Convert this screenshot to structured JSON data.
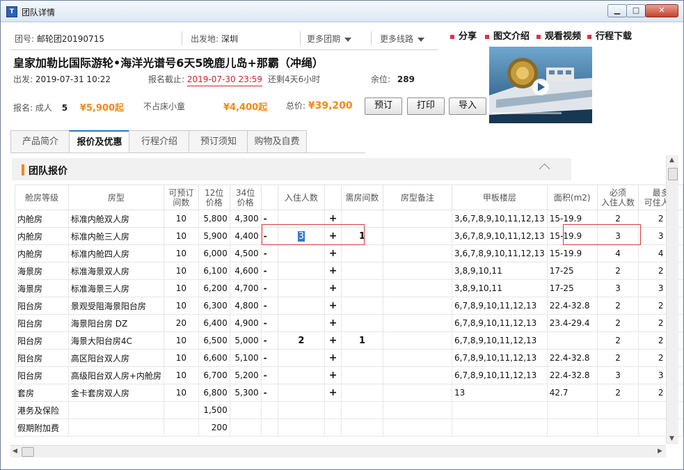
{
  "window": {
    "title": "团队详情",
    "icon": "app-icon",
    "min": "▁",
    "max": "□",
    "close": "✕"
  },
  "info": {
    "group_no_label": "团号:",
    "group_no": "邮轮团20190715",
    "depart_from_label": "出发地:",
    "depart_from": "深圳",
    "more_dates": "更多团期",
    "more_routes": "更多线路"
  },
  "links": [
    "分享",
    "图文介绍",
    "观看视频",
    "行程下载"
  ],
  "trip": {
    "title": "皇家加勒比国际游轮•海洋光谱号6天5晚鹿儿岛+那霸（冲绳）",
    "depart_label": "出发:",
    "depart": "2019-07-31 10:22",
    "deadline_label": "报名截止:",
    "deadline": "2019-07-30 23:59",
    "remaining": "还剩4天6小时",
    "seats_label": "余位:",
    "seats": "289"
  },
  "booking": {
    "adult_label": "报名: 成人",
    "adult_count": "5",
    "adult_price": "¥5,900起",
    "child_label": "不占床小童",
    "child_price": "¥4,400起",
    "total_label": "总价:",
    "total": "¥39,200",
    "buttons": [
      "预订",
      "打印",
      "导入"
    ]
  },
  "tabs": [
    "产品简介",
    "报价及优惠",
    "行程介绍",
    "预订须知",
    "购物及自费"
  ],
  "active_tab": 1,
  "section": {
    "title": "团队报价"
  },
  "table": {
    "headers": [
      "舱房等级",
      "房型",
      "可预订\n间数",
      "12位\n价格",
      "34位\n价格",
      "",
      "入住人数",
      "",
      "需房间数",
      "房型备注",
      "甲板楼层",
      "面积(m2)",
      "必须\n入住人数",
      "最多\n可住人数"
    ],
    "rows": [
      [
        "内舱房",
        "标准内舱双人房",
        "10",
        "5,800",
        "4,300",
        "-",
        "",
        "+",
        "",
        "",
        "3,6,7,8,9,10,11,12,13",
        "15-19.9",
        "2",
        "2"
      ],
      [
        "内舱房",
        "标准内舱三人房",
        "10",
        "5,900",
        "4,400",
        "-",
        "3",
        "+",
        "1",
        "",
        "3,6,7,8,9,10,11,12,13",
        "15-19.9",
        "3",
        "3"
      ],
      [
        "内舱房",
        "标准内舱四人房",
        "10",
        "6,000",
        "4,500",
        "-",
        "",
        "+",
        "",
        "",
        "3,6,7,8,9,10,11,12,13",
        "15-19.9",
        "4",
        "4"
      ],
      [
        "海景房",
        "标准海景双人房",
        "10",
        "6,100",
        "4,600",
        "-",
        "",
        "+",
        "",
        "",
        "3,8,9,10,11",
        "17-25",
        "2",
        "2"
      ],
      [
        "海景房",
        "标准海景三人房",
        "10",
        "6,200",
        "4,700",
        "-",
        "",
        "+",
        "",
        "",
        "3,8,9,10,11",
        "17-25",
        "3",
        "3"
      ],
      [
        "阳台房",
        "景观受阻海景阳台房",
        "10",
        "6,300",
        "4,800",
        "-",
        "",
        "+",
        "",
        "",
        "6,7,8,9,10,11,12,13",
        "22.4-32.8",
        "2",
        "2"
      ],
      [
        "阳台房",
        "海景阳台房 DZ",
        "20",
        "6,400",
        "4,900",
        "-",
        "",
        "+",
        "",
        "",
        "6,7,8,9,10,11,12,13",
        "23.4-29.4",
        "2",
        "2"
      ],
      [
        "阳台房",
        "海景大阳台房4C",
        "10",
        "6,500",
        "5,000",
        "-",
        "2",
        "+",
        "1",
        "",
        "6,7,8,9,10,11,12,13",
        "",
        "2",
        "2"
      ],
      [
        "阳台房",
        "高区阳台双人房",
        "10",
        "6,600",
        "5,100",
        "-",
        "",
        "+",
        "",
        "",
        "6,7,8,9,10,11,12,13",
        "22.4-32.8",
        "2",
        "2"
      ],
      [
        "阳台房",
        "高级阳台双人房+内舱房",
        "10",
        "6,700",
        "5,200",
        "-",
        "",
        "+",
        "",
        "",
        "6,7,8,9,10,11,12,13",
        "22.4-32.8",
        "3",
        "3"
      ],
      [
        "套房",
        "金卡套房双人房",
        "10",
        "6,800",
        "5,300",
        "-",
        "",
        "+",
        "",
        "",
        "13",
        "42.7",
        "2",
        "2"
      ],
      [
        "港务及保险",
        "",
        "",
        "1,500",
        "",
        "",
        "",
        "",
        "",
        "",
        "",
        "",
        "",
        ""
      ],
      [
        "假期附加费",
        "",
        "",
        "200",
        "",
        "",
        "",
        "",
        "",
        "",
        "",
        "",
        "",
        ""
      ]
    ]
  },
  "colors": {
    "accent_orange": "#f08a1a",
    "deadline_red": "#d1242a",
    "tab_active": "#2b78c4",
    "stepper_blue": "#1a3f9c",
    "highlight_box": "#d83a3a"
  }
}
